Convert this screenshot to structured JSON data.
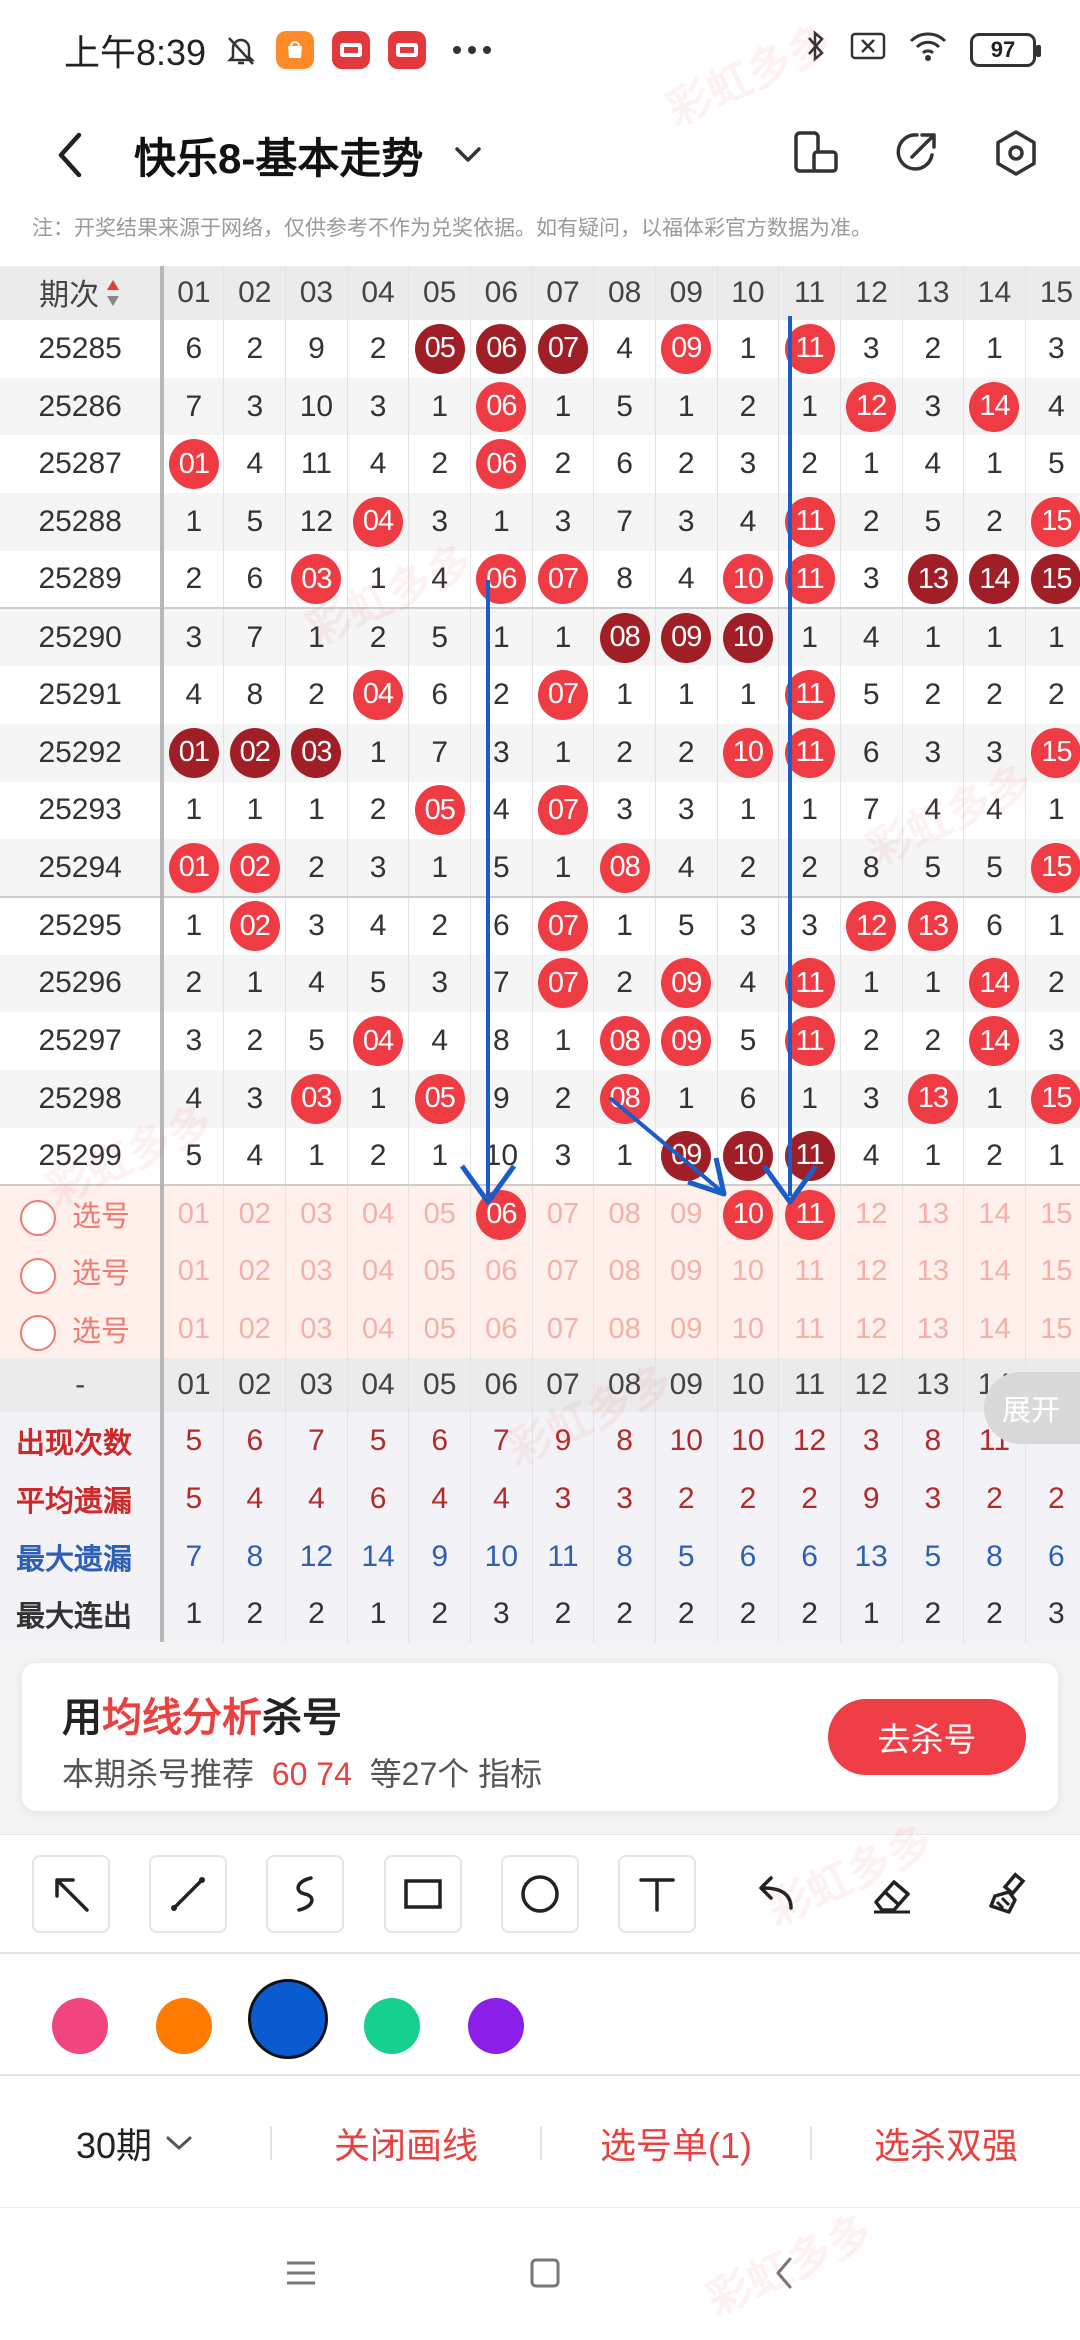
{
  "status_bar": {
    "time": "上午8:39",
    "app_icons": [
      "shopping-app",
      "news-app-1",
      "news-app-2"
    ],
    "battery": "97"
  },
  "header": {
    "title": "快乐8-基本走势"
  },
  "notice": "注：开奖结果来源于网络，仅供参考不作为兑奖依据。如有疑问，以福体彩官方数据为准。",
  "grid": {
    "period_header": "期次",
    "columns": [
      "01",
      "02",
      "03",
      "04",
      "05",
      "06",
      "07",
      "08",
      "09",
      "10",
      "11",
      "12",
      "13",
      "14",
      "15"
    ],
    "rows": [
      {
        "period": "25285",
        "cells": [
          [
            "6",
            ""
          ],
          [
            "2",
            ""
          ],
          [
            "9",
            ""
          ],
          [
            "2",
            ""
          ],
          [
            "05",
            "d"
          ],
          [
            "06",
            "d"
          ],
          [
            "07",
            "d"
          ],
          [
            "4",
            ""
          ],
          [
            "09",
            "r"
          ],
          [
            "1",
            ""
          ],
          [
            "11",
            "r"
          ],
          [
            "3",
            ""
          ],
          [
            "2",
            ""
          ],
          [
            "1",
            ""
          ],
          [
            "3",
            ""
          ]
        ]
      },
      {
        "period": "25286",
        "cells": [
          [
            "7",
            ""
          ],
          [
            "3",
            ""
          ],
          [
            "10",
            ""
          ],
          [
            "3",
            ""
          ],
          [
            "1",
            ""
          ],
          [
            "06",
            "r"
          ],
          [
            "1",
            ""
          ],
          [
            "5",
            ""
          ],
          [
            "1",
            ""
          ],
          [
            "2",
            ""
          ],
          [
            "1",
            ""
          ],
          [
            "12",
            "r"
          ],
          [
            "3",
            ""
          ],
          [
            "14",
            "r"
          ],
          [
            "4",
            ""
          ]
        ]
      },
      {
        "period": "25287",
        "cells": [
          [
            "01",
            "r"
          ],
          [
            "4",
            ""
          ],
          [
            "11",
            ""
          ],
          [
            "4",
            ""
          ],
          [
            "2",
            ""
          ],
          [
            "06",
            "r"
          ],
          [
            "2",
            ""
          ],
          [
            "6",
            ""
          ],
          [
            "2",
            ""
          ],
          [
            "3",
            ""
          ],
          [
            "2",
            ""
          ],
          [
            "1",
            ""
          ],
          [
            "4",
            ""
          ],
          [
            "1",
            ""
          ],
          [
            "5",
            ""
          ]
        ]
      },
      {
        "period": "25288",
        "cells": [
          [
            "1",
            ""
          ],
          [
            "5",
            ""
          ],
          [
            "12",
            ""
          ],
          [
            "04",
            "r"
          ],
          [
            "3",
            ""
          ],
          [
            "1",
            ""
          ],
          [
            "3",
            ""
          ],
          [
            "7",
            ""
          ],
          [
            "3",
            ""
          ],
          [
            "4",
            ""
          ],
          [
            "11",
            "r"
          ],
          [
            "2",
            ""
          ],
          [
            "5",
            ""
          ],
          [
            "2",
            ""
          ],
          [
            "15",
            "r"
          ]
        ]
      },
      {
        "period": "25289",
        "cells": [
          [
            "2",
            ""
          ],
          [
            "6",
            ""
          ],
          [
            "03",
            "r"
          ],
          [
            "1",
            ""
          ],
          [
            "4",
            ""
          ],
          [
            "06",
            "r"
          ],
          [
            "07",
            "r"
          ],
          [
            "8",
            ""
          ],
          [
            "4",
            ""
          ],
          [
            "10",
            "r"
          ],
          [
            "11",
            "r"
          ],
          [
            "3",
            ""
          ],
          [
            "13",
            "d"
          ],
          [
            "14",
            "d"
          ],
          [
            "15",
            "d"
          ]
        ]
      },
      {
        "period": "25290",
        "cells": [
          [
            "3",
            ""
          ],
          [
            "7",
            ""
          ],
          [
            "1",
            ""
          ],
          [
            "2",
            ""
          ],
          [
            "5",
            ""
          ],
          [
            "1",
            ""
          ],
          [
            "1",
            ""
          ],
          [
            "08",
            "d"
          ],
          [
            "09",
            "d"
          ],
          [
            "10",
            "d"
          ],
          [
            "1",
            ""
          ],
          [
            "4",
            ""
          ],
          [
            "1",
            ""
          ],
          [
            "1",
            ""
          ],
          [
            "1",
            ""
          ]
        ]
      },
      {
        "period": "25291",
        "cells": [
          [
            "4",
            ""
          ],
          [
            "8",
            ""
          ],
          [
            "2",
            ""
          ],
          [
            "04",
            "r"
          ],
          [
            "6",
            ""
          ],
          [
            "2",
            ""
          ],
          [
            "07",
            "r"
          ],
          [
            "1",
            ""
          ],
          [
            "1",
            ""
          ],
          [
            "1",
            ""
          ],
          [
            "11",
            "r"
          ],
          [
            "5",
            ""
          ],
          [
            "2",
            ""
          ],
          [
            "2",
            ""
          ],
          [
            "2",
            ""
          ]
        ]
      },
      {
        "period": "25292",
        "cells": [
          [
            "01",
            "d"
          ],
          [
            "02",
            "d"
          ],
          [
            "03",
            "d"
          ],
          [
            "1",
            ""
          ],
          [
            "7",
            ""
          ],
          [
            "3",
            ""
          ],
          [
            "1",
            ""
          ],
          [
            "2",
            ""
          ],
          [
            "2",
            ""
          ],
          [
            "10",
            "r"
          ],
          [
            "11",
            "r"
          ],
          [
            "6",
            ""
          ],
          [
            "3",
            ""
          ],
          [
            "3",
            ""
          ],
          [
            "15",
            "r"
          ]
        ]
      },
      {
        "period": "25293",
        "cells": [
          [
            "1",
            ""
          ],
          [
            "1",
            ""
          ],
          [
            "1",
            ""
          ],
          [
            "2",
            ""
          ],
          [
            "05",
            "r"
          ],
          [
            "4",
            ""
          ],
          [
            "07",
            "r"
          ],
          [
            "3",
            ""
          ],
          [
            "3",
            ""
          ],
          [
            "1",
            ""
          ],
          [
            "1",
            ""
          ],
          [
            "7",
            ""
          ],
          [
            "4",
            ""
          ],
          [
            "4",
            ""
          ],
          [
            "1",
            ""
          ]
        ]
      },
      {
        "period": "25294",
        "cells": [
          [
            "01",
            "r"
          ],
          [
            "02",
            "r"
          ],
          [
            "2",
            ""
          ],
          [
            "3",
            ""
          ],
          [
            "1",
            ""
          ],
          [
            "5",
            ""
          ],
          [
            "1",
            ""
          ],
          [
            "08",
            "r"
          ],
          [
            "4",
            ""
          ],
          [
            "2",
            ""
          ],
          [
            "2",
            ""
          ],
          [
            "8",
            ""
          ],
          [
            "5",
            ""
          ],
          [
            "5",
            ""
          ],
          [
            "15",
            "r"
          ]
        ]
      },
      {
        "period": "25295",
        "cells": [
          [
            "1",
            ""
          ],
          [
            "02",
            "r"
          ],
          [
            "3",
            ""
          ],
          [
            "4",
            ""
          ],
          [
            "2",
            ""
          ],
          [
            "6",
            ""
          ],
          [
            "07",
            "r"
          ],
          [
            "1",
            ""
          ],
          [
            "5",
            ""
          ],
          [
            "3",
            ""
          ],
          [
            "3",
            ""
          ],
          [
            "12",
            "r"
          ],
          [
            "13",
            "r"
          ],
          [
            "6",
            ""
          ],
          [
            "1",
            ""
          ]
        ]
      },
      {
        "period": "25296",
        "cells": [
          [
            "2",
            ""
          ],
          [
            "1",
            ""
          ],
          [
            "4",
            ""
          ],
          [
            "5",
            ""
          ],
          [
            "3",
            ""
          ],
          [
            "7",
            ""
          ],
          [
            "07",
            "r"
          ],
          [
            "2",
            ""
          ],
          [
            "09",
            "r"
          ],
          [
            "4",
            ""
          ],
          [
            "11",
            "r"
          ],
          [
            "1",
            ""
          ],
          [
            "1",
            ""
          ],
          [
            "14",
            "r"
          ],
          [
            "2",
            ""
          ]
        ]
      },
      {
        "period": "25297",
        "cells": [
          [
            "3",
            ""
          ],
          [
            "2",
            ""
          ],
          [
            "5",
            ""
          ],
          [
            "04",
            "r"
          ],
          [
            "4",
            ""
          ],
          [
            "8",
            ""
          ],
          [
            "1",
            ""
          ],
          [
            "08",
            "r"
          ],
          [
            "09",
            "r"
          ],
          [
            "5",
            ""
          ],
          [
            "11",
            "r"
          ],
          [
            "2",
            ""
          ],
          [
            "2",
            ""
          ],
          [
            "14",
            "r"
          ],
          [
            "3",
            ""
          ]
        ]
      },
      {
        "period": "25298",
        "cells": [
          [
            "4",
            ""
          ],
          [
            "3",
            ""
          ],
          [
            "03",
            "r"
          ],
          [
            "1",
            ""
          ],
          [
            "05",
            "r"
          ],
          [
            "9",
            ""
          ],
          [
            "2",
            ""
          ],
          [
            "08",
            "r"
          ],
          [
            "1",
            ""
          ],
          [
            "6",
            ""
          ],
          [
            "1",
            ""
          ],
          [
            "3",
            ""
          ],
          [
            "13",
            "r"
          ],
          [
            "1",
            ""
          ],
          [
            "15",
            "r"
          ]
        ]
      },
      {
        "period": "25299",
        "cells": [
          [
            "5",
            ""
          ],
          [
            "4",
            ""
          ],
          [
            "1",
            ""
          ],
          [
            "2",
            ""
          ],
          [
            "1",
            ""
          ],
          [
            "10",
            ""
          ],
          [
            "3",
            ""
          ],
          [
            "1",
            ""
          ],
          [
            "09",
            "d"
          ],
          [
            "10",
            "d"
          ],
          [
            "11",
            "d"
          ],
          [
            "4",
            ""
          ],
          [
            "1",
            ""
          ],
          [
            "2",
            ""
          ],
          [
            "1",
            ""
          ]
        ]
      }
    ],
    "pick_label": "选号",
    "pick_rows": [
      {
        "selected": {
          "06": true,
          "10": true,
          "11": true
        }
      },
      {
        "selected": {}
      },
      {
        "selected": {}
      }
    ],
    "footer_header": "-",
    "stats": [
      {
        "label": "出现次数",
        "color": "red",
        "values": [
          "5",
          "6",
          "7",
          "5",
          "6",
          "7",
          "9",
          "8",
          "10",
          "10",
          "12",
          "3",
          "8",
          "11",
          ""
        ]
      },
      {
        "label": "平均遗漏",
        "color": "red",
        "values": [
          "5",
          "4",
          "4",
          "6",
          "4",
          "4",
          "3",
          "3",
          "2",
          "2",
          "2",
          "9",
          "3",
          "2",
          "2"
        ]
      },
      {
        "label": "最大遗漏",
        "color": "blue",
        "values": [
          "7",
          "8",
          "12",
          "14",
          "9",
          "10",
          "11",
          "8",
          "5",
          "6",
          "6",
          "13",
          "5",
          "8",
          "6"
        ]
      },
      {
        "label": "最大连出",
        "color": "dark",
        "values": [
          "1",
          "2",
          "2",
          "1",
          "2",
          "3",
          "2",
          "2",
          "2",
          "2",
          "2",
          "1",
          "2",
          "2",
          "3"
        ]
      }
    ],
    "expand_label": "展开"
  },
  "promo": {
    "prefix": "用",
    "highlight": "均线分析",
    "suffix": "杀号",
    "sub_prefix": "本期杀号推荐",
    "sub_numbers": "60 74",
    "sub_mid": "等27个",
    "sub_suffix": "指标",
    "button": "去杀号"
  },
  "tools": [
    "arrow-tool",
    "line-tool",
    "curve-tool",
    "rectangle-tool",
    "circle-tool",
    "text-tool",
    "undo-tool",
    "eraser-tool",
    "clear-tool"
  ],
  "colors": {
    "pink": "#f0457f",
    "orange": "#ff7a00",
    "blue": "#0a5bd0",
    "green": "#16d18e",
    "purple": "#8b1fe8"
  },
  "selected_color": "blue",
  "bottom_bar": {
    "periods": "30期",
    "close_draw": "关闭画线",
    "pick_list": "选号单(1)",
    "kill": "选杀双强"
  },
  "watermark": "彩虹多多"
}
